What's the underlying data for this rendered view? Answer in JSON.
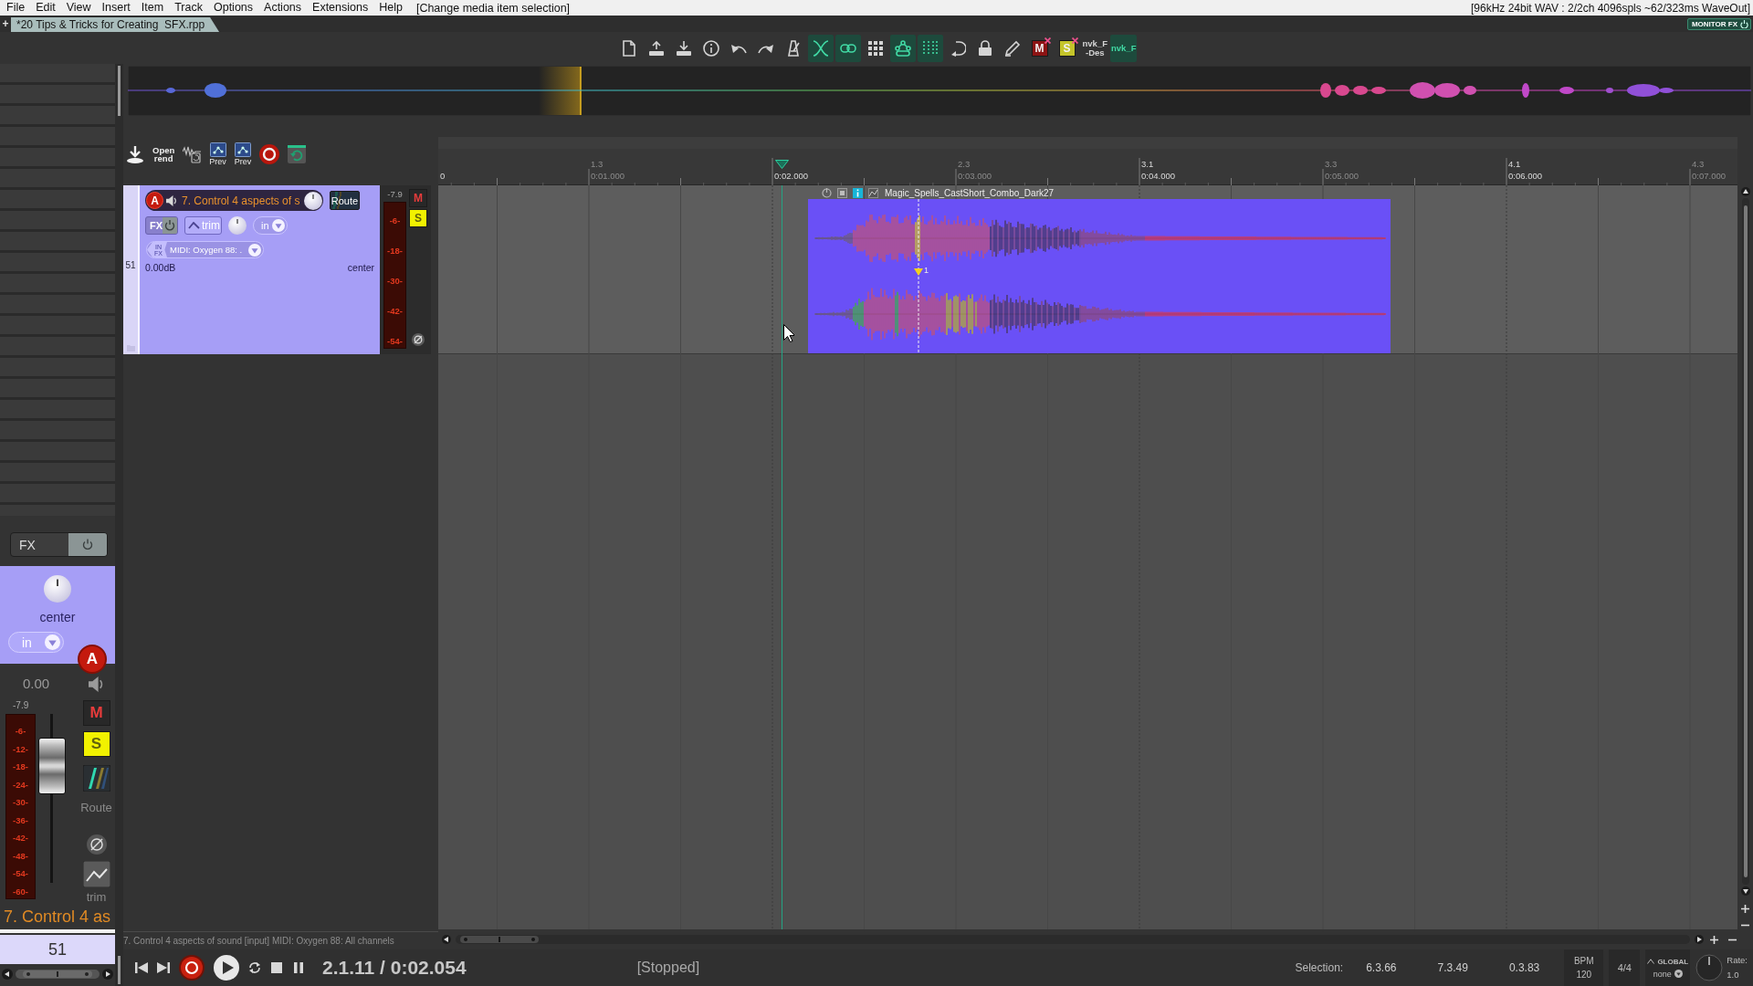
{
  "menu_bar": {
    "items": [
      "File",
      "Edit",
      "View",
      "Insert",
      "Item",
      "Track",
      "Options",
      "Actions",
      "Extensions",
      "Help"
    ],
    "hint": "[Change media item selection]",
    "audio_status": "[96kHz 24bit WAV : 2/2ch 4096spls ~62/323ms WaveOut]"
  },
  "project_tabs": {
    "new_tab": "+",
    "tabs": [
      {
        "label": "*20 Tips & Tricks for Creating  SFX.rpp",
        "selected": true
      }
    ],
    "monitor_fx": "MONITOR FX"
  },
  "toolbar": {
    "buttons": [
      {
        "kind": "icon",
        "on": false
      },
      {
        "kind": "icon",
        "on": false
      },
      {
        "kind": "icon",
        "on": false
      },
      {
        "kind": "icon",
        "on": false
      },
      {
        "kind": "icon",
        "on": false
      },
      {
        "kind": "icon",
        "on": false
      },
      {
        "kind": "icon",
        "on": false
      },
      {
        "kind": "icon",
        "on": true
      },
      {
        "kind": "icon",
        "on": true
      },
      {
        "kind": "icon",
        "on": false
      },
      {
        "kind": "icon",
        "on": true
      },
      {
        "kind": "icon",
        "on": true
      },
      {
        "kind": "icon",
        "on": false
      },
      {
        "kind": "icon",
        "on": false
      },
      {
        "kind": "icon",
        "on": false
      },
      {
        "kind": "badge",
        "label": "M",
        "color": "#8c1414"
      },
      {
        "kind": "badge",
        "label": "S",
        "color": "#c4c42a"
      },
      {
        "kind": "text",
        "lines": [
          "nvk_F",
          "-Des"
        ],
        "on": false
      },
      {
        "kind": "text",
        "lines": [
          "nvk_F"
        ],
        "on": true
      }
    ]
  },
  "track_toolbar": {
    "buttons": [
      {
        "kind": "icon"
      },
      {
        "kind": "text",
        "lines": [
          "Open",
          "rend"
        ]
      },
      {
        "kind": "icon"
      },
      {
        "kind": "labeled",
        "label": "Prev"
      },
      {
        "kind": "labeled",
        "label": "Prev"
      },
      {
        "kind": "record"
      },
      {
        "kind": "icon"
      }
    ]
  },
  "track": {
    "number": "51",
    "name": "7. Control 4 aspects of s",
    "arm_label": "A",
    "armed": true,
    "route": "Route",
    "fx": "FX",
    "trim": "trim",
    "input_mode": "in",
    "input_tag": [
      "IN",
      "FX"
    ],
    "input": "MIDI: Oxygen 88: .",
    "volume": "0.00dB",
    "pan": "center",
    "meter": {
      "peak": "-7.9",
      "scale": [
        "-6-",
        "-18-",
        "-30-",
        "-42-",
        "-54-"
      ]
    },
    "mute": {
      "label": "M",
      "on": false
    },
    "solo": {
      "label": "S",
      "on": true
    }
  },
  "ruler": {
    "marks": [
      {
        "kind": "bar",
        "time": "0"
      },
      {
        "kind": "beat",
        "bar": "1.3",
        "time": "0:01.000"
      },
      {
        "kind": "bar",
        "time": "0:02.000"
      },
      {
        "kind": "beat",
        "bar": "2.3",
        "time": "0:03.000"
      },
      {
        "kind": "bar",
        "bar": "3.1",
        "time": "0:04.000"
      },
      {
        "kind": "beat",
        "bar": "3.3",
        "time": "0:05.000"
      },
      {
        "kind": "bar",
        "bar": "4.1",
        "time": "0:06.000"
      },
      {
        "kind": "beat",
        "bar": "4.3",
        "time": "0:07.000"
      }
    ]
  },
  "media_item": {
    "name": "Magic_Spells_CastShort_Combo_Dark27",
    "take_marker": "1"
  },
  "status_line": "7. Control 4 aspects of sound [input] MIDI: Oxygen 88: All channels",
  "mixer_strip": {
    "fx": "FX",
    "pan": "center",
    "input_mode": "in",
    "arm_label": "A",
    "armed": true,
    "volume": "0.00",
    "peak": "-7.9",
    "scale": [
      "-6-",
      "-12-",
      "-18-",
      "-24-",
      "-30-",
      "-36-",
      "-42-",
      "-48-",
      "-54-",
      "-60-"
    ],
    "fader": {
      "level": 0.79
    },
    "mute": {
      "label": "M",
      "on": false
    },
    "solo": {
      "label": "S",
      "on": true
    },
    "route": "Route",
    "trim": "trim",
    "name": "7. Control 4 as",
    "number": "51"
  },
  "transport": {
    "buttons": [
      {
        "kind": "skip-start"
      },
      {
        "kind": "skip-end"
      },
      {
        "kind": "record"
      },
      {
        "kind": "play"
      },
      {
        "kind": "loop"
      },
      {
        "kind": "stop"
      },
      {
        "kind": "pause"
      }
    ],
    "position": "2.1.11 / 0:02.054",
    "state": "[Stopped]",
    "selection": {
      "label": "Selection:",
      "values": [
        "6.3.66",
        "7.3.49",
        "0.3.83"
      ]
    },
    "bpm": {
      "label": "BPM",
      "value": "120"
    },
    "time_signature": "4/4",
    "timebase": {
      "label": "GLOBAL",
      "value": "none"
    },
    "rate": {
      "label": "Rate:",
      "value": "1.0"
    }
  }
}
